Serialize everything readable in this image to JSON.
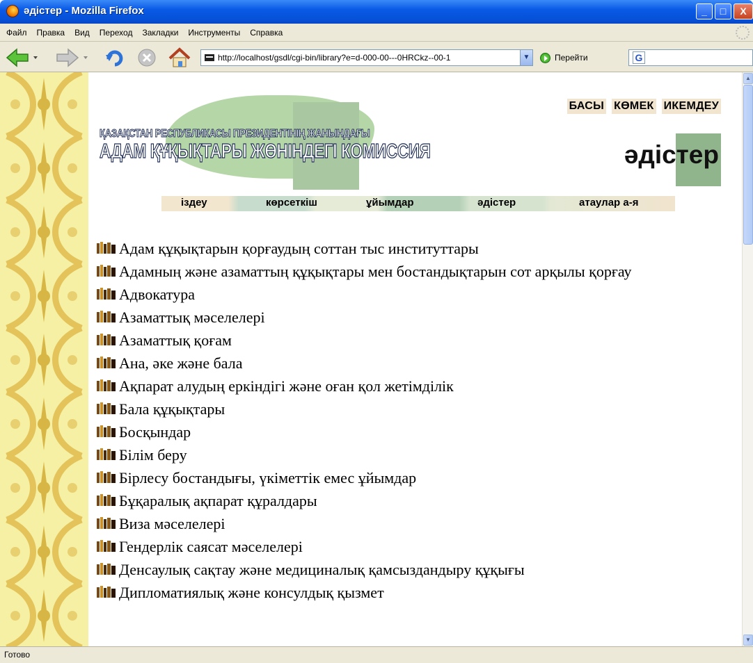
{
  "window": {
    "title": "әдістер - Mozilla Firefox",
    "min": "_",
    "max": "□",
    "close": "X"
  },
  "menu": [
    "Файл",
    "Правка",
    "Вид",
    "Переход",
    "Закладки",
    "Инструменты",
    "Справка"
  ],
  "navbar": {
    "url": "http://localhost/gsdl/cgi-bin/library?e=d-000-00---0HRCkz--00-1",
    "go_label": "Перейти",
    "search_value": ""
  },
  "site": {
    "top_links": [
      "БАСЫ",
      "КӨМЕК",
      "ИКЕМДЕУ"
    ],
    "logo_line1": "ҚАЗАҚСТАН РЕСПУБЛИКАСЫ ПРЕЗИДЕНТІНІҢ ЖАНЫНДАҒЫ",
    "logo_line2": "АДАМ ҚҰҚЫҚТАРЫ ЖӨНІНДЕГІ КОМИССИЯ",
    "page_title": "әдістер",
    "tabs": [
      "іздеу",
      "көрсеткіш",
      "ұйымдар",
      "әдістер",
      "атаулар а-я"
    ]
  },
  "items": [
    "Адам құқықтарын қорғаудың соттан тыс институттары",
    "Адамның және азаматтың құқықтары мен бостандықтарын сот арқылы қорғау",
    "Адвокатура",
    "Азаматтық мәселелері",
    "Азаматтық қоғам",
    "Ана, әке және бала",
    "Ақпарат алудың еркіндігі және оған қол жетімділік",
    "Бала құқықтары",
    "Босқындар",
    "Білім беру",
    "Бірлесу бостандығы, үкіметтік емес ұйымдар",
    "Бұқаралық ақпарат құралдары",
    "Виза мәселелері",
    "Гендерлік саясат мәселелері",
    "Денсаулық сақтау және медициналық қамсыздандыру құқығы",
    "Дипломатиялық және консулдық қызмет"
  ],
  "status": "Готово"
}
